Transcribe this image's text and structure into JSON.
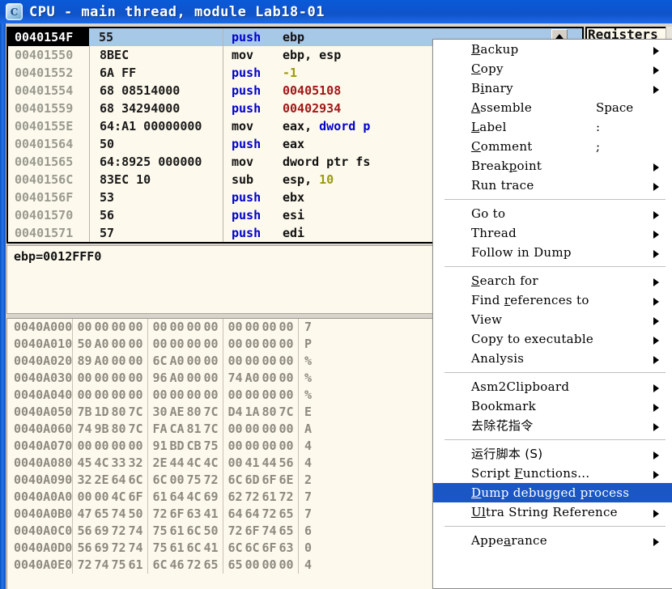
{
  "window": {
    "icon": "cpu-window-icon",
    "icon_letter": "C",
    "title": "CPU - main thread, module Lab18-01"
  },
  "panes": {
    "registers_title": "Registers (",
    "info_text": "ebp=0012FFF0"
  },
  "disassembly": {
    "rows": [
      {
        "address": "0040154F",
        "hex": "55",
        "mnemonic": "push",
        "mnemonic_color": "blue",
        "operand": "ebp",
        "operand_color": "black",
        "selected": true
      },
      {
        "address": "00401550",
        "hex": "8BEC",
        "mnemonic": "mov",
        "mnemonic_color": "black",
        "operand": "ebp, esp",
        "operand_color": "black",
        "selected": false
      },
      {
        "address": "00401552",
        "hex": "6A FF",
        "mnemonic": "push",
        "mnemonic_color": "blue",
        "operand": "-1",
        "operand_color": "olive",
        "selected": false
      },
      {
        "address": "00401554",
        "hex": "68 08514000",
        "mnemonic": "push",
        "mnemonic_color": "blue",
        "operand": "00405108",
        "operand_color": "red",
        "selected": false
      },
      {
        "address": "00401559",
        "hex": "68 34294000",
        "mnemonic": "push",
        "mnemonic_color": "blue",
        "operand": "00402934",
        "operand_color": "red",
        "selected": false
      },
      {
        "address": "0040155E",
        "hex": "64:A1 00000000",
        "mnemonic": "mov",
        "mnemonic_color": "black",
        "operand": "eax, dword p",
        "operand_color": "mixed",
        "selected": false
      },
      {
        "address": "00401564",
        "hex": "50",
        "mnemonic": "push",
        "mnemonic_color": "blue",
        "operand": "eax",
        "operand_color": "black",
        "selected": false
      },
      {
        "address": "00401565",
        "hex": "64:8925 000000",
        "mnemonic": "mov",
        "mnemonic_color": "black",
        "operand": "dword ptr fs",
        "operand_color": "mixed",
        "selected": false
      },
      {
        "address": "0040156C",
        "hex": "83EC 10",
        "mnemonic": "sub",
        "mnemonic_color": "black",
        "operand": "esp, 10",
        "operand_color": "mixed",
        "selected": false
      },
      {
        "address": "0040156F",
        "hex": "53",
        "mnemonic": "push",
        "mnemonic_color": "blue",
        "operand": "ebx",
        "operand_color": "black",
        "selected": false
      },
      {
        "address": "00401570",
        "hex": "56",
        "mnemonic": "push",
        "mnemonic_color": "blue",
        "operand": "esi",
        "operand_color": "black",
        "selected": false
      },
      {
        "address": "00401571",
        "hex": "57",
        "mnemonic": "push",
        "mnemonic_color": "blue",
        "operand": "edi",
        "operand_color": "black",
        "selected": false
      }
    ]
  },
  "dump": {
    "rows": [
      {
        "address": "0040A000",
        "bytes": [
          "00",
          "00",
          "00",
          "00",
          "00",
          "00",
          "00",
          "00",
          "00",
          "00",
          "00",
          "00"
        ],
        "ascii": "7"
      },
      {
        "address": "0040A010",
        "bytes": [
          "50",
          "A0",
          "00",
          "00",
          "00",
          "00",
          "00",
          "00",
          "00",
          "00",
          "00",
          "00"
        ],
        "ascii": "P"
      },
      {
        "address": "0040A020",
        "bytes": [
          "89",
          "A0",
          "00",
          "00",
          "6C",
          "A0",
          "00",
          "00",
          "00",
          "00",
          "00",
          "00"
        ],
        "ascii": "%"
      },
      {
        "address": "0040A030",
        "bytes": [
          "00",
          "00",
          "00",
          "00",
          "96",
          "A0",
          "00",
          "00",
          "74",
          "A0",
          "00",
          "00"
        ],
        "ascii": "%"
      },
      {
        "address": "0040A040",
        "bytes": [
          "00",
          "00",
          "00",
          "00",
          "00",
          "00",
          "00",
          "00",
          "00",
          "00",
          "00",
          "00"
        ],
        "ascii": "%"
      },
      {
        "address": "0040A050",
        "bytes": [
          "7B",
          "1D",
          "80",
          "7C",
          "30",
          "AE",
          "80",
          "7C",
          "D4",
          "1A",
          "80",
          "7C"
        ],
        "ascii": "E"
      },
      {
        "address": "0040A060",
        "bytes": [
          "74",
          "9B",
          "80",
          "7C",
          "FA",
          "CA",
          "81",
          "7C",
          "00",
          "00",
          "00",
          "00"
        ],
        "ascii": "A"
      },
      {
        "address": "0040A070",
        "bytes": [
          "00",
          "00",
          "00",
          "00",
          "91",
          "BD",
          "CB",
          "75",
          "00",
          "00",
          "00",
          "00"
        ],
        "ascii": "4"
      },
      {
        "address": "0040A080",
        "bytes": [
          "45",
          "4C",
          "33",
          "32",
          "2E",
          "44",
          "4C",
          "4C",
          "00",
          "41",
          "44",
          "56"
        ],
        "ascii": "4"
      },
      {
        "address": "0040A090",
        "bytes": [
          "32",
          "2E",
          "64",
          "6C",
          "6C",
          "00",
          "75",
          "72",
          "6C",
          "6D",
          "6F",
          "6E"
        ],
        "ascii": "2"
      },
      {
        "address": "0040A0A0",
        "bytes": [
          "00",
          "00",
          "4C",
          "6F",
          "61",
          "64",
          "4C",
          "69",
          "62",
          "72",
          "61",
          "72"
        ],
        "ascii": "7"
      },
      {
        "address": "0040A0B0",
        "bytes": [
          "47",
          "65",
          "74",
          "50",
          "72",
          "6F",
          "63",
          "41",
          "64",
          "64",
          "72",
          "65"
        ],
        "ascii": "7"
      },
      {
        "address": "0040A0C0",
        "bytes": [
          "56",
          "69",
          "72",
          "74",
          "75",
          "61",
          "6C",
          "50",
          "72",
          "6F",
          "74",
          "65"
        ],
        "ascii": "6"
      },
      {
        "address": "0040A0D0",
        "bytes": [
          "56",
          "69",
          "72",
          "74",
          "75",
          "61",
          "6C",
          "41",
          "6C",
          "6C",
          "6F",
          "63"
        ],
        "ascii": "0"
      },
      {
        "address": "0040A0E0",
        "bytes": [
          "72",
          "74",
          "75",
          "61",
          "6C",
          "46",
          "72",
          "65",
          "65",
          "00",
          "00",
          "00"
        ],
        "ascii": "4"
      }
    ]
  },
  "context_menu": {
    "items": [
      {
        "type": "item",
        "label": "Backup",
        "mnemonic": "B",
        "accel": "",
        "submenu": true,
        "highlighted": false
      },
      {
        "type": "item",
        "label": "Copy",
        "mnemonic": "C",
        "accel": "",
        "submenu": true,
        "highlighted": false
      },
      {
        "type": "item",
        "label": "Binary",
        "mnemonic": "i",
        "accel": "",
        "submenu": true,
        "highlighted": false
      },
      {
        "type": "item",
        "label": "Assemble",
        "mnemonic": "A",
        "accel": "Space",
        "submenu": false,
        "highlighted": false
      },
      {
        "type": "item",
        "label": "Label",
        "mnemonic": "L",
        "accel": ":",
        "submenu": false,
        "highlighted": false
      },
      {
        "type": "item",
        "label": "Comment",
        "mnemonic": "C",
        "accel": ";",
        "submenu": false,
        "highlighted": false
      },
      {
        "type": "item",
        "label": "Breakpoint",
        "mnemonic": "p",
        "accel": "",
        "submenu": true,
        "highlighted": false
      },
      {
        "type": "item",
        "label": "Run trace",
        "mnemonic": "",
        "accel": "",
        "submenu": true,
        "highlighted": false
      },
      {
        "type": "separator"
      },
      {
        "type": "item",
        "label": "Go to",
        "mnemonic": "",
        "accel": "",
        "submenu": true,
        "highlighted": false
      },
      {
        "type": "item",
        "label": "Thread",
        "mnemonic": "",
        "accel": "",
        "submenu": true,
        "highlighted": false
      },
      {
        "type": "item",
        "label": "Follow in Dump",
        "mnemonic": "",
        "accel": "",
        "submenu": true,
        "highlighted": false
      },
      {
        "type": "separator"
      },
      {
        "type": "item",
        "label": "Search for",
        "mnemonic": "S",
        "accel": "",
        "submenu": true,
        "highlighted": false
      },
      {
        "type": "item",
        "label": "Find references to",
        "mnemonic": "r",
        "accel": "",
        "submenu": true,
        "highlighted": false
      },
      {
        "type": "item",
        "label": "View",
        "mnemonic": "",
        "accel": "",
        "submenu": true,
        "highlighted": false
      },
      {
        "type": "item",
        "label": "Copy to executable",
        "mnemonic": "",
        "accel": "",
        "submenu": true,
        "highlighted": false
      },
      {
        "type": "item",
        "label": "Analysis",
        "mnemonic": "",
        "accel": "",
        "submenu": true,
        "highlighted": false
      },
      {
        "type": "separator"
      },
      {
        "type": "item",
        "label": "Asm2Clipboard",
        "mnemonic": "",
        "accel": "",
        "submenu": true,
        "highlighted": false
      },
      {
        "type": "item",
        "label": "Bookmark",
        "mnemonic": "",
        "accel": "",
        "submenu": true,
        "highlighted": false
      },
      {
        "type": "item",
        "label": "去除花指令",
        "mnemonic": "",
        "accel": "",
        "submenu": true,
        "highlighted": false,
        "cjk": true
      },
      {
        "type": "separator"
      },
      {
        "type": "item",
        "label": "运行脚本 (S)",
        "mnemonic": "",
        "accel": "",
        "submenu": true,
        "highlighted": false,
        "cjk": true
      },
      {
        "type": "item",
        "label": "Script Functions...",
        "mnemonic": "F",
        "accel": "",
        "submenu": true,
        "highlighted": false
      },
      {
        "type": "item",
        "label": "Dump debugged process",
        "mnemonic": "D",
        "accel": "",
        "submenu": false,
        "highlighted": true
      },
      {
        "type": "item",
        "label": "Ultra String Reference",
        "mnemonic": "Ul",
        "accel": "",
        "submenu": true,
        "highlighted": false
      },
      {
        "type": "separator"
      },
      {
        "type": "item",
        "label": "Appearance",
        "mnemonic": "a",
        "accel": "",
        "submenu": true,
        "highlighted": false
      }
    ]
  },
  "colors": {
    "titlebar": "#0d55d0",
    "menu_highlight": "#1a56c4",
    "selection": "#a8c8e8",
    "pane_background": "#fdf9ec",
    "operand_red": "#a01818",
    "operand_olive": "#9a9a10",
    "mnemonic_blue": "#0000cc",
    "scroll_marker_red": "#c01818"
  }
}
